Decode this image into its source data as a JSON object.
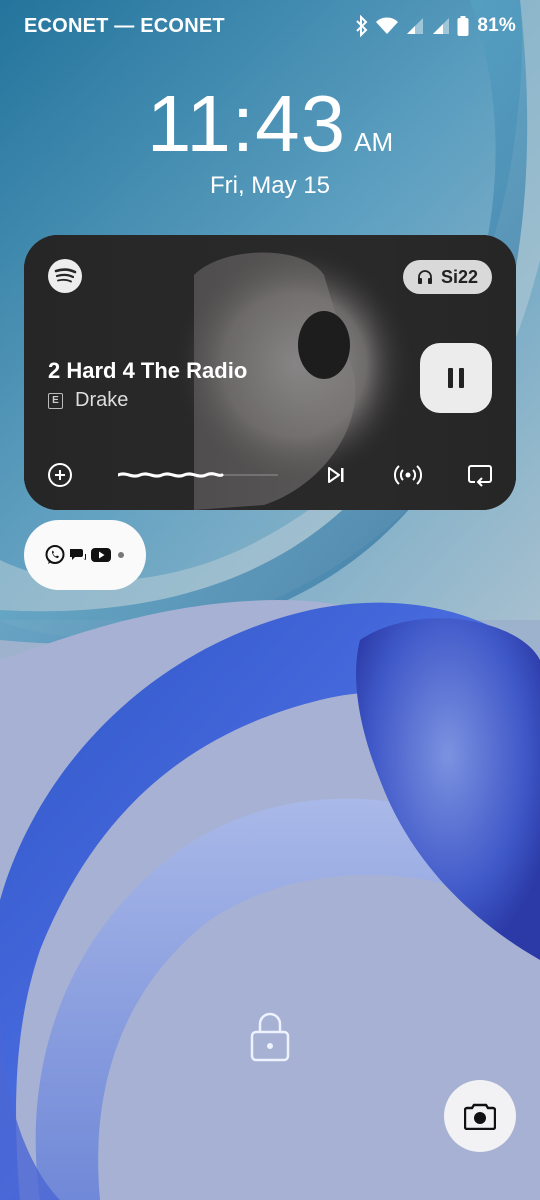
{
  "status_bar": {
    "carrier": "ECONET — ECONET",
    "battery_percent": "81%",
    "icons": [
      "bluetooth-icon",
      "wifi-icon",
      "signal-icon",
      "signal-icon",
      "battery-icon"
    ]
  },
  "lockscreen": {
    "time": "11:43",
    "ampm": "AM",
    "date": "Fri, May 15"
  },
  "media": {
    "app_icon": "spotify-icon",
    "device_icon": "headphones-icon",
    "device_name": "Si22",
    "title": "2 Hard 4 The Radio",
    "explicit_label": "E",
    "artist": "Drake",
    "play_state_icon": "pause-icon",
    "controls": [
      "add-icon",
      "seekbar",
      "skip-next-icon",
      "broadcast-icon",
      "repeat-icon"
    ]
  },
  "notifications": {
    "app_icons": [
      "whatsapp-icon",
      "messages-icon",
      "youtube-icon",
      "more-dot-icon"
    ]
  },
  "bottom": {
    "lock_icon": "lock-icon",
    "camera_icon": "camera-icon"
  },
  "colors": {
    "card_bg": "#262626",
    "chip_bg": "#d9d9d9",
    "pill_bg": "#fafafa"
  }
}
